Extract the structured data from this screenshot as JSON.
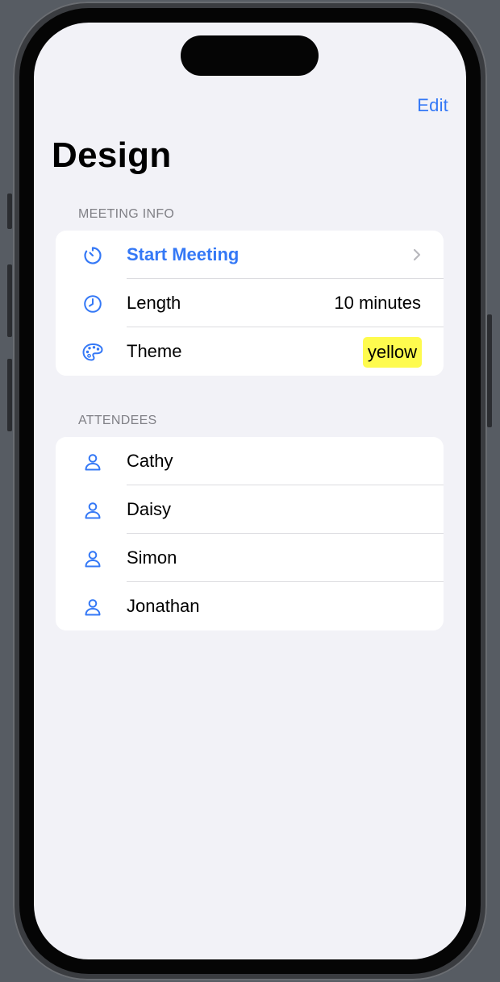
{
  "nav": {
    "edit_label": "Edit"
  },
  "page": {
    "title": "Design"
  },
  "meeting_info": {
    "header": "MEETING INFO",
    "rows": [
      {
        "icon": "timer-icon",
        "label": "Start Meeting",
        "accessory": "chevron-right-icon"
      },
      {
        "icon": "clock-icon",
        "label": "Length",
        "value": "10 minutes"
      },
      {
        "icon": "palette-icon",
        "label": "Theme",
        "value": "yellow"
      }
    ]
  },
  "attendees": {
    "header": "ATTENDEES",
    "items": [
      {
        "icon": "person-icon",
        "name": "Cathy"
      },
      {
        "icon": "person-icon",
        "name": "Daisy"
      },
      {
        "icon": "person-icon",
        "name": "Simon"
      },
      {
        "icon": "person-icon",
        "name": "Jonathan"
      }
    ]
  },
  "colors": {
    "accent": "#3478f6",
    "background": "#f2f2f7",
    "theme_badge": "#fefb4e"
  }
}
